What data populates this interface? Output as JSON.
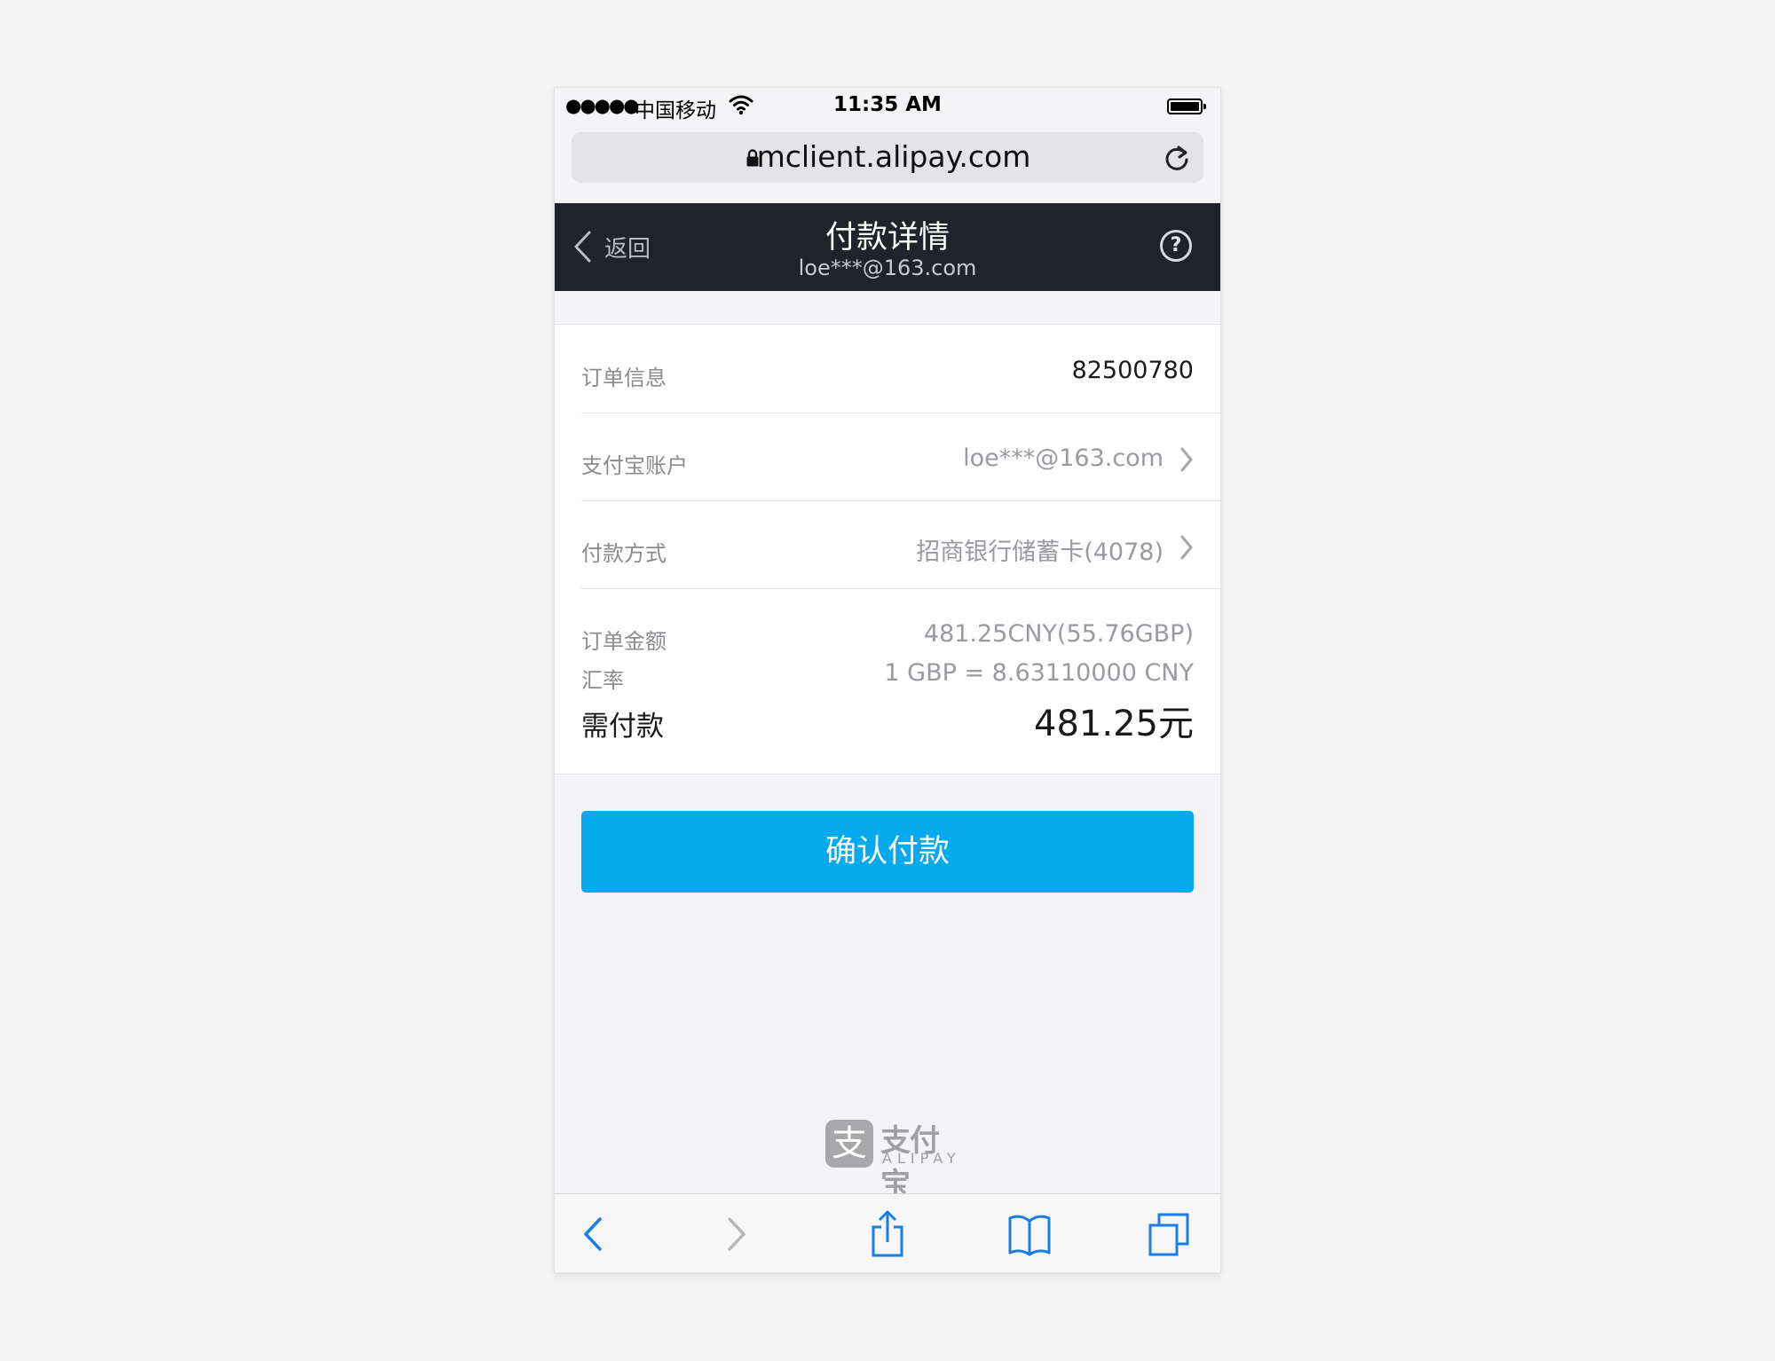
{
  "status_bar": {
    "signal": "●●●●●",
    "carrier": "中国移动",
    "time": "11:35 AM"
  },
  "browser": {
    "url": "mclient.alipay.com"
  },
  "header": {
    "back_label": "返回",
    "title": "付款详情",
    "subtitle": "loe***@163.com",
    "help_symbol": "?"
  },
  "details": {
    "order_info": {
      "label": "订单信息",
      "value": "82500780"
    },
    "account": {
      "label": "支付宝账户",
      "value": "loe***@163.com"
    },
    "pay_method": {
      "label": "付款方式",
      "value": "招商银行储蓄卡(4078)"
    },
    "order_amount": {
      "label": "订单金额",
      "value": "481.25CNY(55.76GBP)"
    },
    "exchange_rate": {
      "label": "汇率",
      "value": "1 GBP = 8.63110000 CNY"
    },
    "total_due": {
      "label": "需付款",
      "value": "481.25元"
    }
  },
  "confirm_button": "确认付款",
  "logo": {
    "mark": "支",
    "cn": "支付宝",
    "en": "ALIPAY"
  },
  "colors": {
    "accent": "#04a9ee",
    "header_bg": "#20232b",
    "toolbar_icon": "#1a7ee6"
  },
  "toolbar_icons": [
    "back-icon",
    "forward-icon",
    "share-icon",
    "bookmarks-icon",
    "tabs-icon"
  ]
}
